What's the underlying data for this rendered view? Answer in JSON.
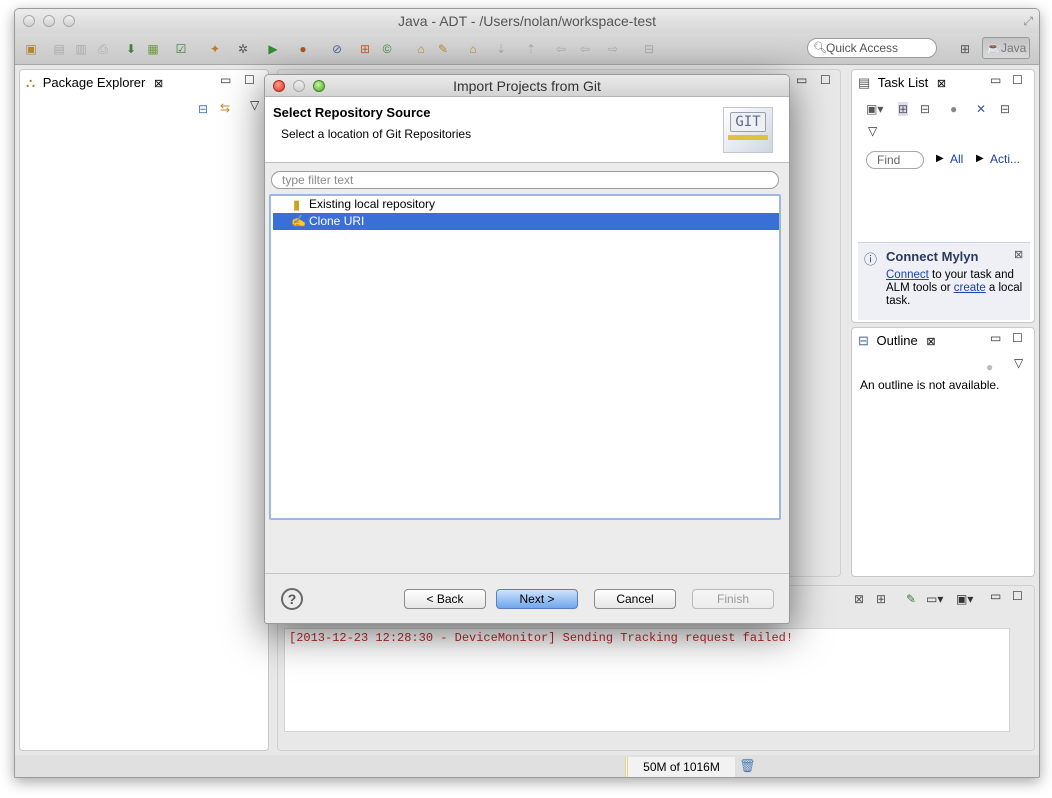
{
  "window": {
    "title": "Java - ADT - /Users/nolan/workspace-test"
  },
  "toolbar": {
    "quick_access_placeholder": "Quick Access",
    "perspective_label": "Java"
  },
  "package_explorer": {
    "tab_label": "Package Explorer"
  },
  "task_list": {
    "tab_label": "Task List",
    "find_placeholder": "Find",
    "filter_all": "All",
    "filter_activate": "Acti..."
  },
  "mylyn": {
    "title": "Connect Mylyn",
    "link_connect": "Connect",
    "text_middle": " to your task and ALM tools or ",
    "link_create": "create",
    "text_end": " a local task."
  },
  "outline": {
    "tab_label": "Outline",
    "empty_message": "An outline is not available."
  },
  "console": {
    "error_line": "[2013-12-23 12:28:30 - DeviceMonitor] Sending Tracking request failed!"
  },
  "status": {
    "heap": "50M of 1016M"
  },
  "dialog": {
    "title": "Import Projects from Git",
    "header_title": "Select Repository Source",
    "header_subtitle": "Select a location of Git Repositories",
    "logo_text": "GIT",
    "filter_placeholder": "type filter text",
    "items": [
      {
        "label": "Existing local repository",
        "icon": "database-icon",
        "selected": false
      },
      {
        "label": "Clone URI",
        "icon": "clone-icon",
        "selected": true
      }
    ],
    "buttons": {
      "help": "?",
      "back": "< Back",
      "next": "Next >",
      "cancel": "Cancel",
      "finish": "Finish"
    }
  },
  "colors": {
    "selection": "#3a6fd8",
    "link": "#1a3fb0",
    "console_error": "#c0282b"
  }
}
